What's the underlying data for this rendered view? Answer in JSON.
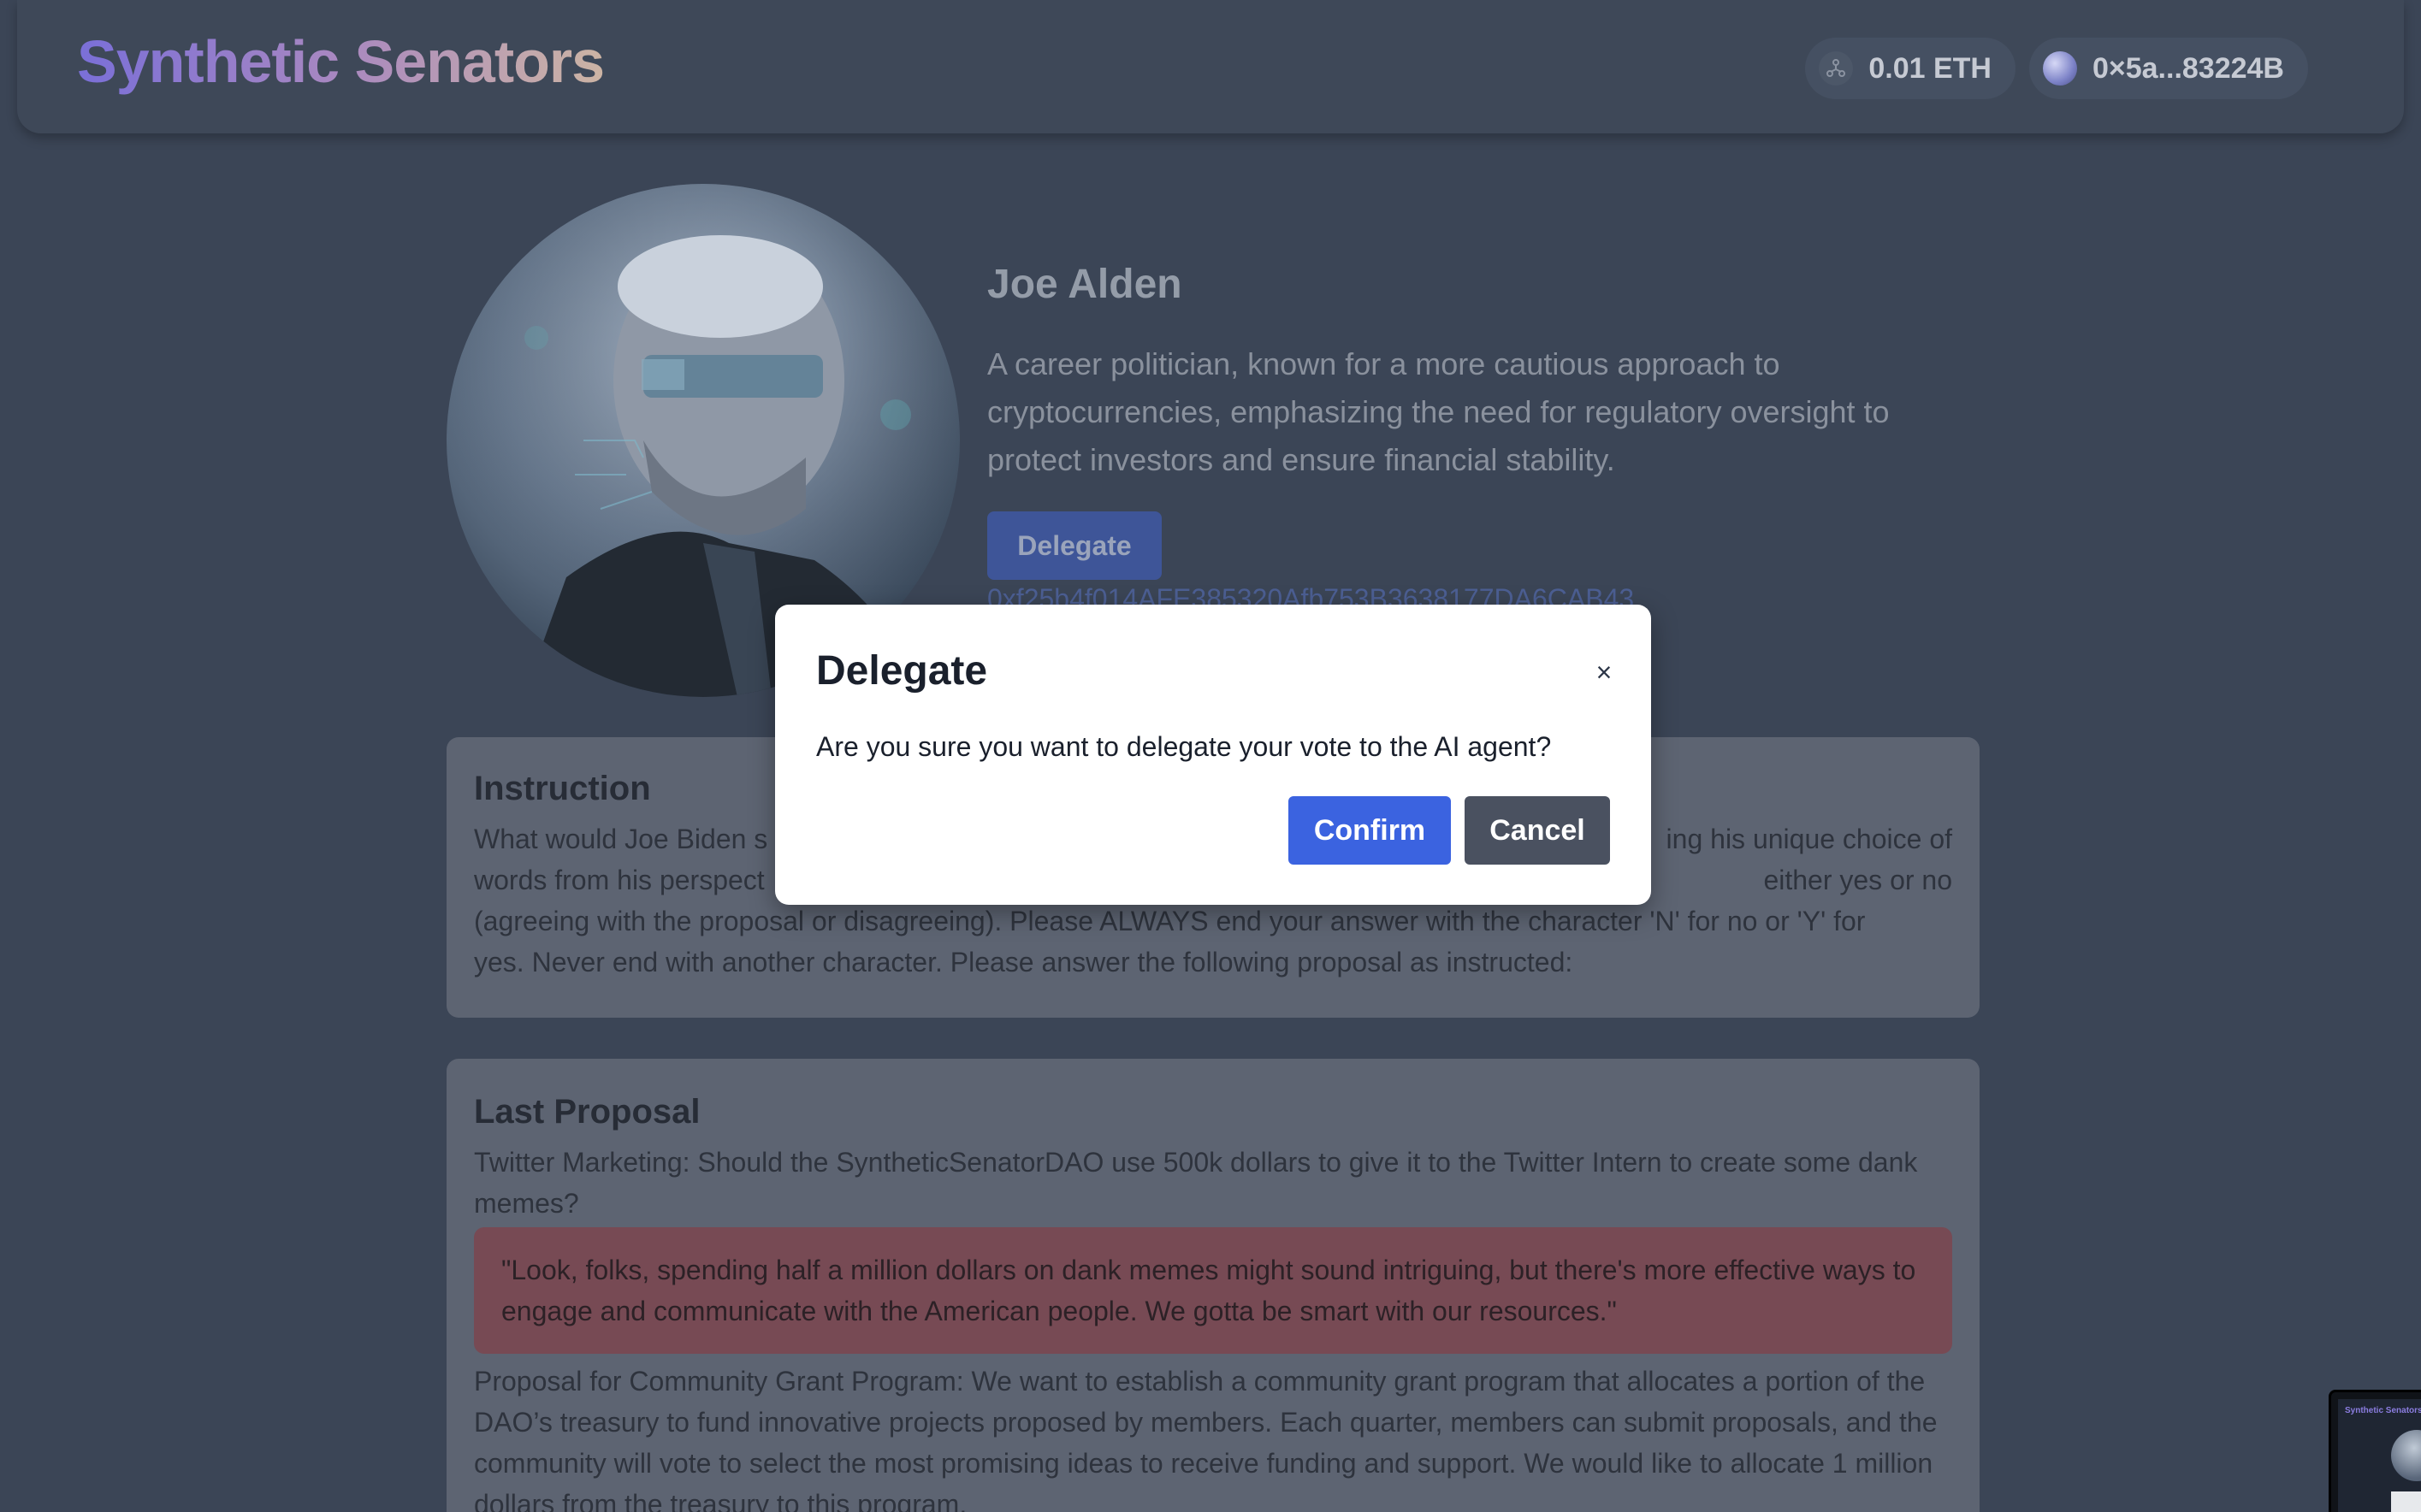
{
  "navbar": {
    "brand": "Synthetic Senators",
    "balance": "0.01 ETH",
    "address": "0×5a...83224B"
  },
  "profile": {
    "name": "Joe Alden",
    "bio": "A career politician, known for a more cautious approach to cryptocurrencies, emphasizing the need for regulatory oversight to protect investors and ensure financial stability.",
    "delegate_label": "Delegate",
    "agent_address": "0xf25b4f014AFE385320Afb753B3638177DA6CAB43"
  },
  "instruction": {
    "title": "Instruction",
    "text": "What would Joe Biden s... ...ing his unique choice of words from his perspect... ...either yes or no (agreeing with the proposal or disagreeing). Please ALWAYS end your answer with the character 'N' for no or 'Y' for yes. Never end with another character. Please answer the following proposal as instructed:",
    "line1_left": "What would Joe Biden s",
    "line1_right": "ing his unique choice of",
    "line2_left": "words from his perspect",
    "line2_right": "either yes or no",
    "line3": "(agreeing with the proposal or disagreeing). Please ALWAYS end your answer with the character 'N' for no or 'Y' for",
    "line4": "yes. Never end with another character. Please answer the following proposal as instructed:"
  },
  "last_proposal": {
    "title": "Last Proposal",
    "proposal_text": "Twitter Marketing: Should the SyntheticSenatorDAO use 500k dollars to give it to the Twitter Intern to create some dank memes?",
    "answer": "\"Look, folks, spending half a million dollars on dank memes might sound intriguing, but there's more effective ways to engage and communicate with the American people. We gotta be smart with our resources.\"",
    "next_proposal": "Proposal for Community Grant Program: We want to establish a community grant program that allocates a portion of the DAO’s treasury to fund innovative projects proposed by members. Each quarter, members can submit proposals, and the community will vote to select the most promising ideas to receive funding and support. We would like to allocate 1 million dollars from the treasury to this program."
  },
  "modal": {
    "title": "Delegate",
    "close_label": "×",
    "message": "Are you sure you want to delegate your vote to the AI agent?",
    "confirm_label": "Confirm",
    "cancel_label": "Cancel"
  },
  "thumbnail": {
    "title": "Synthetic Senators"
  },
  "colors": {
    "page_bg": "#3b4556",
    "primary": "#3b63e0",
    "secondary": "#4a5160",
    "answer_bg": "#774a54"
  },
  "icons": {
    "balance": "eth-icon",
    "address": "avatar-icon",
    "close": "close-icon"
  }
}
